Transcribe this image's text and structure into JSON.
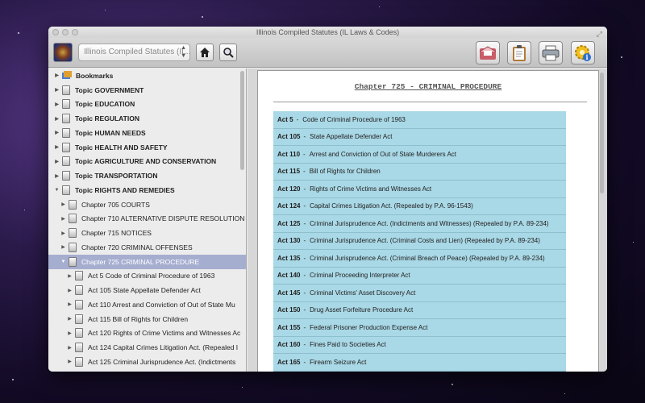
{
  "window": {
    "title": "Illinois Compiled Statutes (IL Laws & Codes)"
  },
  "toolbar": {
    "statute_select_value": "Illinois Compiled Statutes (IL...",
    "buttons": [
      "home-icon",
      "search-icon",
      "mail-icon",
      "clipboard-icon",
      "printer-icon",
      "settings-info-icon"
    ]
  },
  "sidebar": {
    "bookmarks_label": "Bookmarks",
    "topics": [
      "Topic   GOVERNMENT",
      "Topic   EDUCATION",
      "Topic   REGULATION",
      "Topic   HUMAN NEEDS",
      "Topic   HEALTH AND SAFETY",
      "Topic   AGRICULTURE AND CONSERVATION",
      "Topic   TRANSPORTATION",
      "Topic   RIGHTS AND REMEDIES"
    ],
    "chapters": [
      "Chapter 705  COURTS",
      "Chapter 710  ALTERNATIVE DISPUTE RESOLUTION",
      "Chapter 715  NOTICES",
      "Chapter 720  CRIMINAL OFFENSES",
      "Chapter 725  CRIMINAL PROCEDURE"
    ],
    "acts": [
      "Act 5   Code of Criminal Procedure of 1963",
      "Act 105  State Appellate Defender Act",
      "Act 110  Arrest and Conviction of Out of State Mu",
      "Act 115  Bill of Rights for Children",
      "Act 120  Rights of Crime Victims and Witnesses Ac",
      "Act 124  Capital Crimes Litigation Act. (Repealed I",
      "Act 125  Criminal Jurisprudence Act. (Indictments"
    ]
  },
  "main": {
    "chapter_heading": "Chapter 725 - CRIMINAL PROCEDURE",
    "acts": [
      {
        "num": "Act 5",
        "title": "Code of Criminal Procedure of 1963"
      },
      {
        "num": "Act 105",
        "title": "State Appellate Defender Act"
      },
      {
        "num": "Act 110",
        "title": "Arrest and Conviction of Out of State Murderers Act"
      },
      {
        "num": "Act 115",
        "title": "Bill of Rights for Children"
      },
      {
        "num": "Act 120",
        "title": "Rights of Crime Victims and Witnesses Act"
      },
      {
        "num": "Act 124",
        "title": "Capital Crimes Litigation Act. (Repealed by P.A. 96-1543)"
      },
      {
        "num": "Act 125",
        "title": "Criminal Jurisprudence Act. (Indictments and Witnesses) (Repealed by P.A. 89-234)"
      },
      {
        "num": "Act 130",
        "title": "Criminal Jurisprudence Act. (Criminal Costs and Lien) (Repealed by P.A. 89-234)"
      },
      {
        "num": "Act 135",
        "title": "Criminal Jurisprudence Act. (Criminal Breach of Peace) (Repealed by P.A. 89-234)"
      },
      {
        "num": "Act 140",
        "title": "Criminal Proceeding Interpreter Act"
      },
      {
        "num": "Act 145",
        "title": "Criminal Victims' Asset Discovery Act"
      },
      {
        "num": "Act 150",
        "title": "Drug Asset Forfeiture Procedure Act"
      },
      {
        "num": "Act 155",
        "title": "Federal Prisoner Production Expense Act"
      },
      {
        "num": "Act 160",
        "title": "Fines Paid to Societies Act"
      },
      {
        "num": "Act 165",
        "title": "Firearm Seizure Act"
      }
    ]
  },
  "colors": {
    "selected_row": "#a6aed0",
    "act_table_bg": "#a9d8e6"
  }
}
